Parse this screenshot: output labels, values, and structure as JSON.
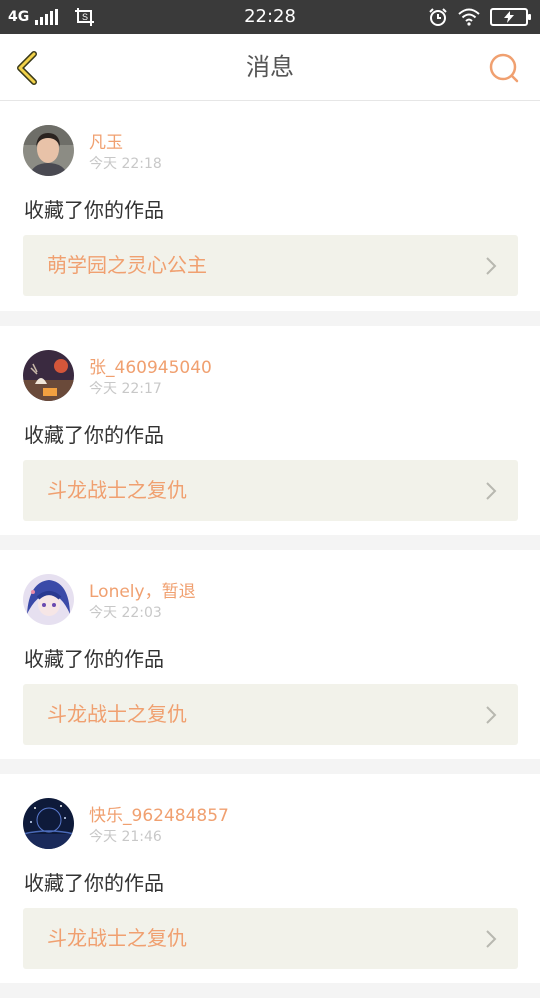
{
  "status_bar": {
    "network": "4G",
    "time": "22:28",
    "icons": [
      "signal-icon",
      "screenshot-icon",
      "alarm-icon",
      "wifi-icon",
      "battery-charging-icon"
    ]
  },
  "header": {
    "title": "消息",
    "back_icon": "chevron-left-icon",
    "search_icon": "search-icon",
    "accent_color": "#f0a070"
  },
  "messages": [
    {
      "user": "凡玉",
      "time": "今天 22:18",
      "action": "收藏了你的作品",
      "work": "萌学园之灵心公主"
    },
    {
      "user": "张_460945040",
      "time": "今天 22:17",
      "action": "收藏了你的作品",
      "work": "斗龙战士之复仇"
    },
    {
      "user": "Lonely，暂退",
      "time": "今天 22:03",
      "action": "收藏了你的作品",
      "work": "斗龙战士之复仇"
    },
    {
      "user": "快乐_962484857",
      "time": "今天 21:46",
      "action": "收藏了你的作品",
      "work": "斗龙战士之复仇"
    }
  ]
}
